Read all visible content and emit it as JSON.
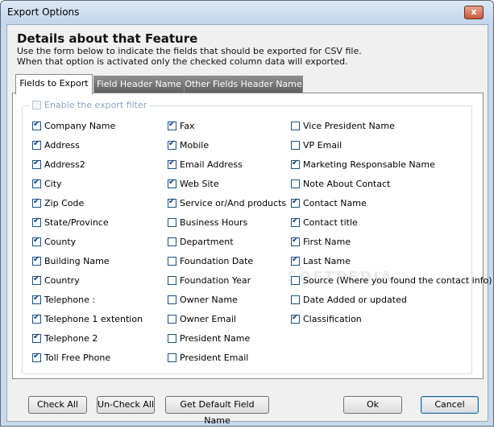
{
  "window": {
    "title": "Export Options",
    "close_glyph": "x"
  },
  "heading": "Details about that  Feature",
  "description": [
    "Use the form below to indicate the fields that should be exported for CSV file.",
    "When that option is activated only the checked column data will exported."
  ],
  "tabs": [
    {
      "label": "Fields to Export",
      "active": true
    },
    {
      "label": "Field Header Name",
      "active": false
    },
    {
      "label": "Other Fields Header Name",
      "active": false
    }
  ],
  "enable_filter": {
    "label": "Enable the export filter",
    "checked": false,
    "enabled": false
  },
  "watermark": "SOFTPEDIA",
  "columns": [
    [
      {
        "label": "Company Name",
        "checked": true
      },
      {
        "label": "Address",
        "checked": true
      },
      {
        "label": "Address2",
        "checked": true
      },
      {
        "label": "City",
        "checked": true
      },
      {
        "label": "Zip Code",
        "checked": true
      },
      {
        "label": "State/Province",
        "checked": true
      },
      {
        "label": "County",
        "checked": true
      },
      {
        "label": "Building Name",
        "checked": true
      },
      {
        "label": "Country",
        "checked": true
      },
      {
        "label": "Telephone :",
        "checked": true
      },
      {
        "label": "Telephone 1 extention",
        "checked": true
      },
      {
        "label": "Telephone 2",
        "checked": true
      },
      {
        "label": "Toll Free Phone",
        "checked": true
      }
    ],
    [
      {
        "label": "Fax",
        "checked": true
      },
      {
        "label": "Mobile",
        "checked": true
      },
      {
        "label": "Email Address",
        "checked": true
      },
      {
        "label": "Web Site",
        "checked": true
      },
      {
        "label": "Service or/And products",
        "checked": true
      },
      {
        "label": "Business Hours",
        "checked": false
      },
      {
        "label": "Department",
        "checked": false
      },
      {
        "label": "Foundation Date",
        "checked": false
      },
      {
        "label": "Foundation Year",
        "checked": false
      },
      {
        "label": "Owner Name",
        "checked": false
      },
      {
        "label": "Owner Email",
        "checked": false
      },
      {
        "label": "President Name",
        "checked": false
      },
      {
        "label": "President Email",
        "checked": false
      }
    ],
    [
      {
        "label": "Vice President Name",
        "checked": false
      },
      {
        "label": "VP Email",
        "checked": false
      },
      {
        "label": "Marketing Responsable Name",
        "checked": true
      },
      {
        "label": "Note About Contact",
        "checked": false
      },
      {
        "label": "Contact Name",
        "checked": true
      },
      {
        "label": "Contact title",
        "checked": true
      },
      {
        "label": "First Name",
        "checked": true
      },
      {
        "label": "Last Name",
        "checked": true
      },
      {
        "label": "Source (Where you found the contact info)",
        "checked": false
      },
      {
        "label": "Date Added or updated",
        "checked": false
      },
      {
        "label": "Classification",
        "checked": true
      }
    ]
  ],
  "buttons": {
    "check_all": "Check All",
    "uncheck_all": "Un-Check All",
    "default_names": "Get Default Field Name",
    "ok": "Ok",
    "cancel": "Cancel"
  }
}
